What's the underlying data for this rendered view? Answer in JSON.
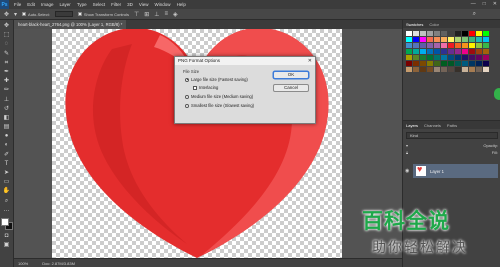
{
  "app": {
    "logo": "Ps"
  },
  "menu": [
    "File",
    "Edit",
    "Image",
    "Layer",
    "Type",
    "Select",
    "Filter",
    "3D",
    "View",
    "Window",
    "Help"
  ],
  "window_controls": [
    "—",
    "□",
    "✕"
  ],
  "options_bar": {
    "auto_select_label": "Auto-Select:",
    "show_transform_label": "Show Transform Controls"
  },
  "document": {
    "tab_title": "heart-black-heart_2764.png @ 100% (Layer 1, RGB/8) *",
    "zoom": "100%",
    "doc_size": "Doc: 2.87M/3.83M"
  },
  "dialog": {
    "title": "PNG Format Options",
    "group_label": "File Size",
    "options": [
      {
        "label": "Large file size (Fastest saving)",
        "selected": true
      },
      {
        "label": "Medium file size (Medium saving)",
        "selected": false
      },
      {
        "label": "Smallest file size (Slowest saving)",
        "selected": false
      }
    ],
    "interlacing_label": "Interlacing",
    "ok_label": "OK",
    "cancel_label": "Cancel"
  },
  "panels": {
    "swatches_tabs": [
      "Swatches",
      "Color"
    ],
    "layers_tabs": [
      "Layers",
      "Channels",
      "Paths"
    ],
    "kind_label": "Kind",
    "opacity_label": "Opacity:",
    "fill_label": "Fill:",
    "layer_name": "Layer 1"
  },
  "swatch_colors": [
    "#ffffff",
    "#e0e0e0",
    "#c0c0c0",
    "#a0a0a0",
    "#808080",
    "#606060",
    "#404040",
    "#202020",
    "#000000",
    "#ff0000",
    "#ffff00",
    "#00ff00",
    "#00ffff",
    "#0000ff",
    "#ff00ff",
    "#f26c4f",
    "#f68e56",
    "#fbaf5c",
    "#fff467",
    "#acd372",
    "#7cc576",
    "#3bb878",
    "#1abbb4",
    "#00bff3",
    "#438ccb",
    "#5574b9",
    "#605ca8",
    "#855fa8",
    "#a763a9",
    "#f06ea9",
    "#ed1c24",
    "#f26522",
    "#f7941d",
    "#fff200",
    "#8dc73f",
    "#39b54a",
    "#00a651",
    "#00a99d",
    "#00aeef",
    "#0072bc",
    "#0054a6",
    "#2e3192",
    "#662d91",
    "#92278f",
    "#ec008c",
    "#9e0b0f",
    "#a0410d",
    "#a3620a",
    "#aba000",
    "#598527",
    "#197b30",
    "#007236",
    "#00746b",
    "#0076a3",
    "#004b80",
    "#003471",
    "#1b1464",
    "#440e62",
    "#630460",
    "#9e005d",
    "#790000",
    "#7b2e00",
    "#7d4900",
    "#827b00",
    "#406618",
    "#005e20",
    "#005826",
    "#005952",
    "#005b7f",
    "#003663",
    "#002157",
    "#0d004c",
    "#c69c6d",
    "#8c6239",
    "#603913",
    "#754c24",
    "#998675",
    "#736357",
    "#534741",
    "#37302a",
    "#c7b299",
    "#a67c52",
    "#736357",
    "#e6d5c3"
  ],
  "watermark": {
    "line1": "百科全说",
    "line2": "助你轻松解决"
  }
}
